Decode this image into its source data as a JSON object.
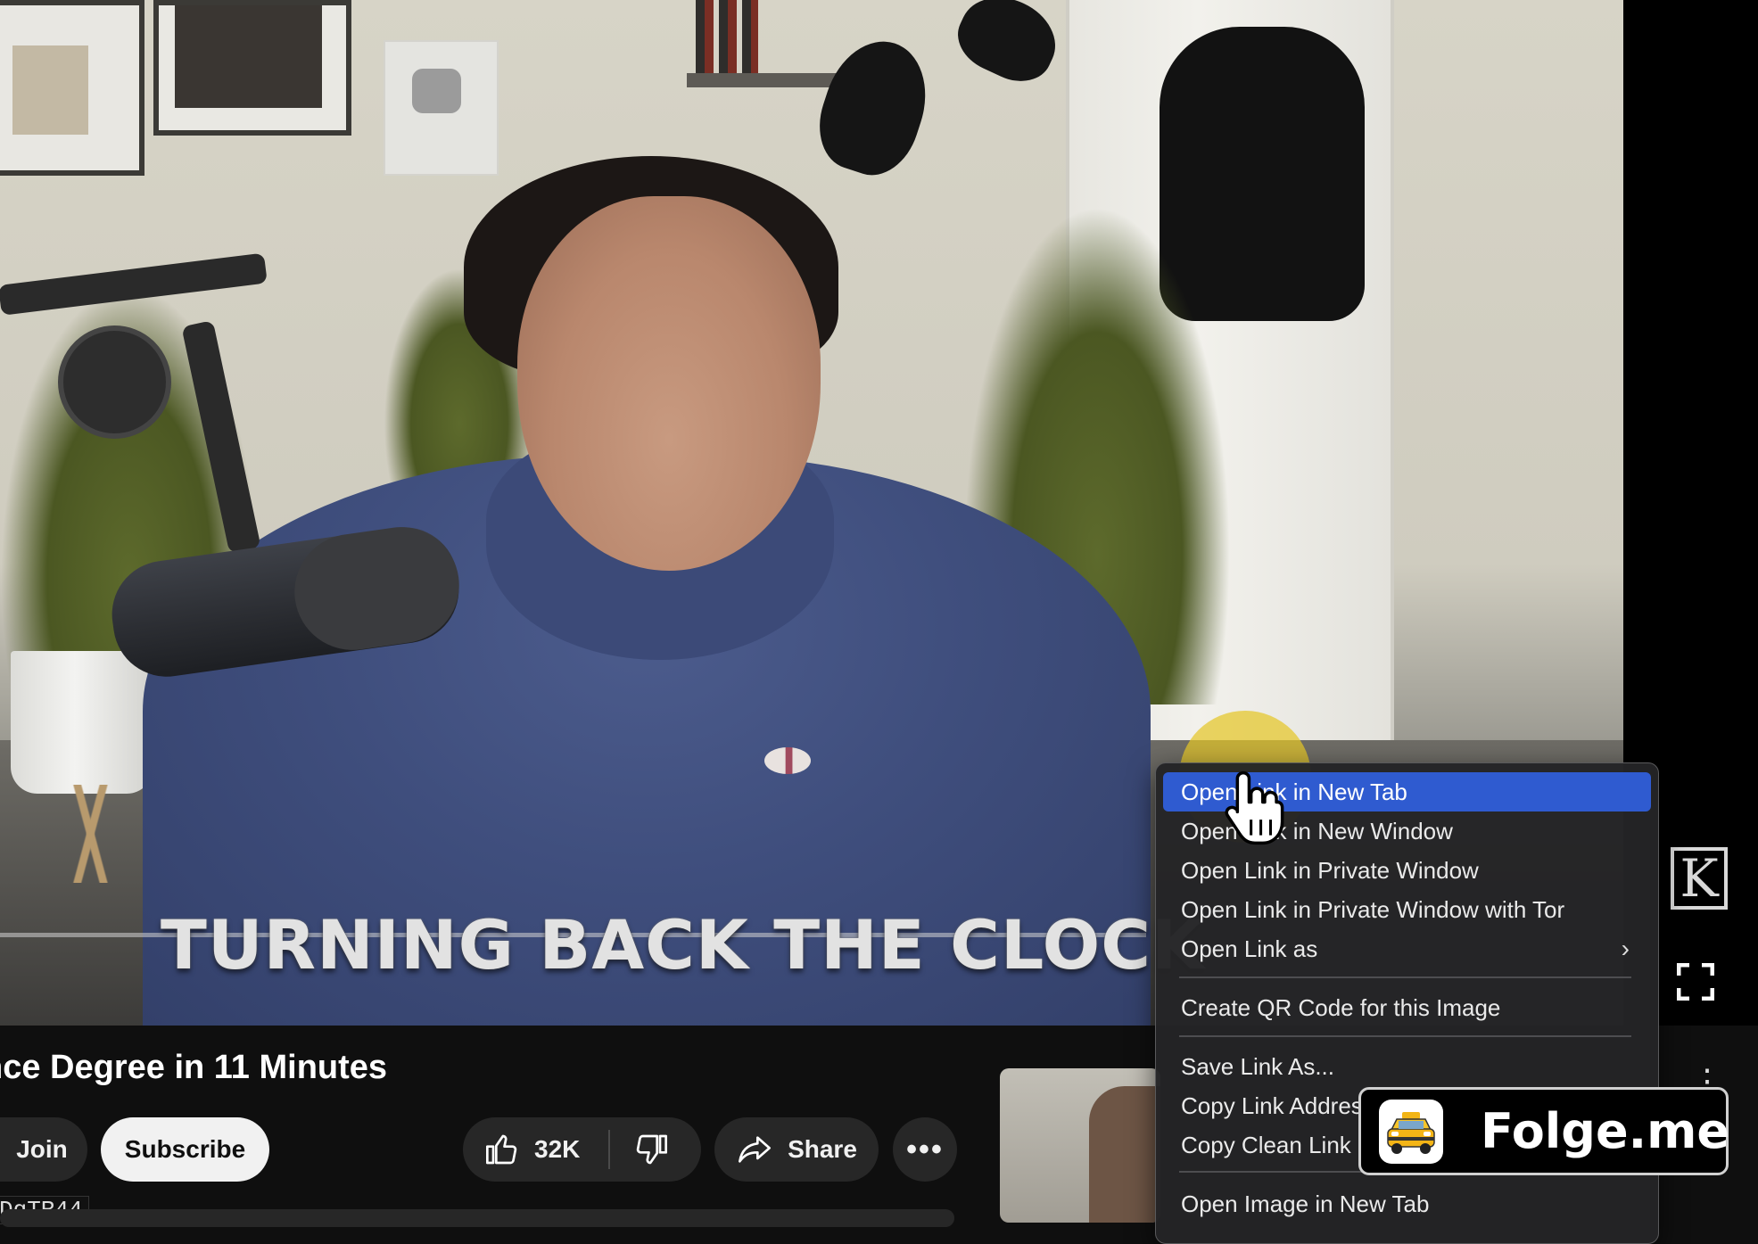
{
  "video": {
    "caption": "TURNING BACK THE CLOCK",
    "watermark_glyph": "K"
  },
  "page": {
    "video_title": "nce Degree in 11 Minutes",
    "join_label": "Join",
    "subscribe_label": "Subscribe",
    "like_count": "32K",
    "share_label": "Share",
    "more_label": "•••",
    "id_tag": "DqTR44",
    "side_kebab": "⋮"
  },
  "context_menu": {
    "items": [
      {
        "label": "Open Link in New Tab",
        "active": true
      },
      {
        "label": "Open Link in New Window"
      },
      {
        "label": "Open Link in Private Window"
      },
      {
        "label": "Open Link in Private Window with Tor"
      },
      {
        "label": "Open Link as",
        "submenu": true
      },
      {
        "label": "Create QR Code for this Image"
      },
      {
        "label": "Save Link As..."
      },
      {
        "label": "Copy Link Address"
      },
      {
        "label": "Copy Clean Link"
      },
      {
        "label": "Open Image in New Tab"
      }
    ],
    "chevron": "›"
  },
  "badge": {
    "text": "Folge.me"
  },
  "colors": {
    "menu_highlight": "#2f5bd0",
    "cursor_highlight": "#e4c628",
    "page_bg": "#0f0f0f"
  },
  "icons": [
    "thumbs-up-icon",
    "thumbs-down-icon",
    "share-arrow-icon",
    "fullscreen-icon",
    "hand-cursor-icon",
    "taxi-icon"
  ]
}
